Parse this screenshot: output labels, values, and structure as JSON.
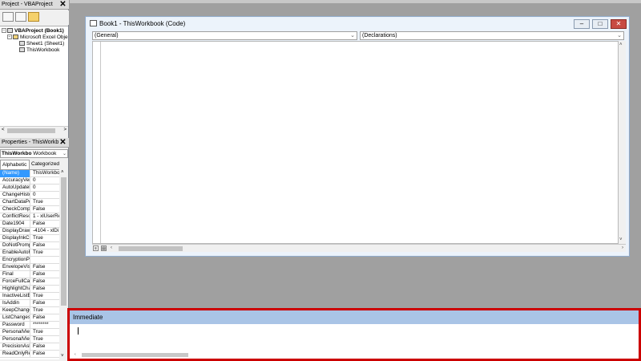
{
  "project_panel": {
    "title": "Project - VBAProject",
    "close": "✕",
    "tree": {
      "root": "VBAProject (Book1)",
      "folder": "Microsoft Excel Obje",
      "items": [
        "Sheet1 (Sheet1)",
        "ThisWorkbook"
      ]
    },
    "scroll_left": "<",
    "scroll_right": ">"
  },
  "properties_panel": {
    "title": "Properties - ThisWorkb",
    "close": "✕",
    "object_name": "ThisWorkbo",
    "object_type": "Workbook",
    "tabs": [
      "Alphabetic",
      "Categorized"
    ],
    "rows": [
      {
        "name": "(Name)",
        "value": "ThisWorkbo"
      },
      {
        "name": "AccuracyVers",
        "value": "0"
      },
      {
        "name": "AutoUpdateF",
        "value": "0"
      },
      {
        "name": "ChangeHistor",
        "value": "0"
      },
      {
        "name": "ChartDataPoi",
        "value": "True"
      },
      {
        "name": "CheckCompat",
        "value": "False"
      },
      {
        "name": "ConflictResol",
        "value": "1 - xlUserRe"
      },
      {
        "name": "Date1904",
        "value": "False"
      },
      {
        "name": "DisplayDrawi",
        "value": "-4104 - xlDi"
      },
      {
        "name": "DisplayInkCo",
        "value": "True"
      },
      {
        "name": "DoNotPromptI",
        "value": "False"
      },
      {
        "name": "EnableAutoRe",
        "value": "True"
      },
      {
        "name": "EncryptionPro",
        "value": ""
      },
      {
        "name": "EnvelopeVisib",
        "value": "False"
      },
      {
        "name": "Final",
        "value": "False"
      },
      {
        "name": "ForceFullCalc",
        "value": "False"
      },
      {
        "name": "HighlightChar",
        "value": "False"
      },
      {
        "name": "InactiveListBo",
        "value": "True"
      },
      {
        "name": "IsAddin",
        "value": "False"
      },
      {
        "name": "KeepChangeH",
        "value": "True"
      },
      {
        "name": "ListChangesC",
        "value": "False"
      },
      {
        "name": "Password",
        "value": "********"
      },
      {
        "name": "PersonalView",
        "value": "True"
      },
      {
        "name": "PersonalView",
        "value": "True"
      },
      {
        "name": "PrecisionAsD",
        "value": "False"
      },
      {
        "name": "ReadOnlyRec",
        "value": "False"
      }
    ]
  },
  "code_window": {
    "title": "Book1 - ThisWorkbook (Code)",
    "object_combo": "(General)",
    "proc_combo": "(Declarations)",
    "minimize": "–",
    "maximize": "□",
    "close": "✕"
  },
  "immediate_window": {
    "title": "Immediate"
  }
}
